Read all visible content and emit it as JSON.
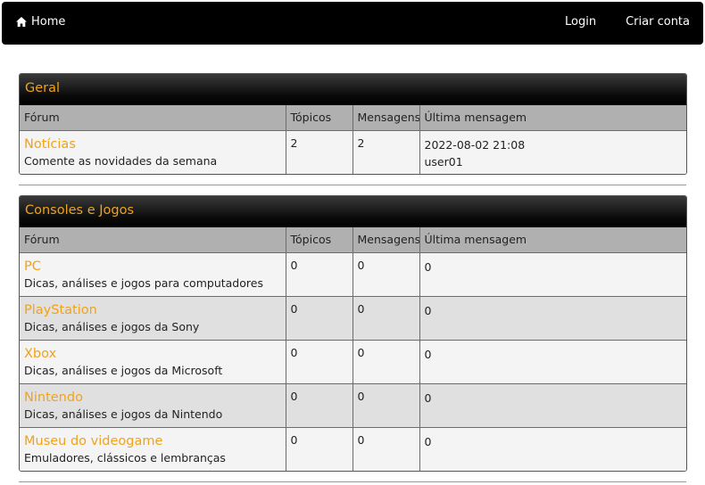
{
  "nav": {
    "home_label": "Home",
    "home_icon": "home-icon",
    "login_label": "Login",
    "register_label": "Criar conta"
  },
  "columns": {
    "forum": "Fórum",
    "topics": "Tópicos",
    "messages": "Mensagens",
    "last": "Última mensagem"
  },
  "sections": [
    {
      "title": "Geral",
      "forums": [
        {
          "name": "Notícias",
          "description": "Comente as novidades da semana",
          "topics": "2",
          "messages": "2",
          "last_date": "2022-08-02 21:08",
          "last_user": "user01"
        }
      ]
    },
    {
      "title": "Consoles e Jogos",
      "forums": [
        {
          "name": "PC",
          "description": "Dicas, análises e jogos para computadores",
          "topics": "0",
          "messages": "0",
          "last_date": "0",
          "last_user": ""
        },
        {
          "name": "PlayStation",
          "description": "Dicas, análises e jogos da Sony",
          "topics": "0",
          "messages": "0",
          "last_date": "0",
          "last_user": ""
        },
        {
          "name": "Xbox",
          "description": "Dicas, análises e jogos da Microsoft",
          "topics": "0",
          "messages": "0",
          "last_date": "0",
          "last_user": ""
        },
        {
          "name": "Nintendo",
          "description": "Dicas, análises e jogos da Nintendo",
          "topics": "0",
          "messages": "0",
          "last_date": "0",
          "last_user": ""
        },
        {
          "name": "Museu do videogame",
          "description": "Emuladores, clássicos e lembranças",
          "topics": "0",
          "messages": "0",
          "last_date": "0",
          "last_user": ""
        }
      ]
    }
  ],
  "colors": {
    "accent": "#f0a21b",
    "navbar": "#000000",
    "header_row": "#b0b0b0"
  }
}
